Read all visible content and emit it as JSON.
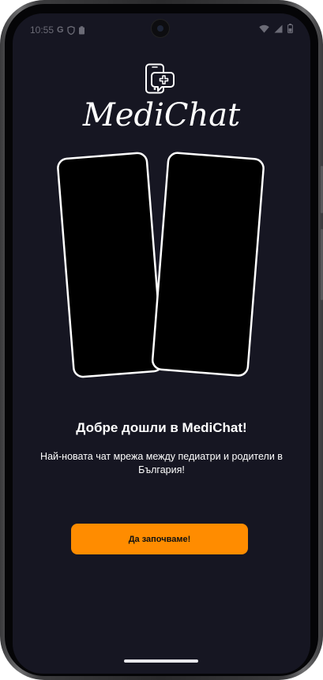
{
  "status_bar": {
    "time": "10:55",
    "icons": [
      "google-icon",
      "shield-icon",
      "clipboard-icon",
      "wifi-icon",
      "signal-icon",
      "battery-icon"
    ]
  },
  "app": {
    "name": "MediChat",
    "logo_icon": "phone-medical-icon"
  },
  "welcome": {
    "title": "Добре дошли в MediChat!",
    "subtitle": "Най-новата чат мрежа между педиатри и родители в България!"
  },
  "cta": {
    "label": "Да започваме!"
  },
  "colors": {
    "background": "#161622",
    "accent": "#ff8c00",
    "text": "#ffffff"
  }
}
